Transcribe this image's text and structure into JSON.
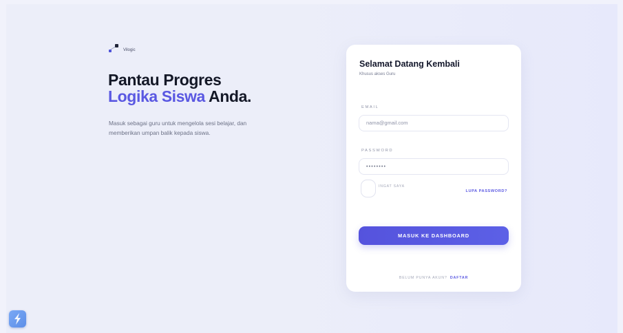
{
  "brand": {
    "name": "Vilogic",
    "logo_icon": "vilogic-logo-icon"
  },
  "hero": {
    "line1": "Pantau Progres",
    "accent": "Logika Siswa",
    "suffix": " Anda.",
    "description": "Masuk sebagai guru untuk mengelola sesi belajar, dan memberikan umpan balik kepada siswa."
  },
  "login": {
    "title": "Selamat Datang Kembali",
    "subtitle": "Khusus akses Guru",
    "email_label": "EMAIL",
    "email_placeholder": "nama@gmail.com",
    "password_label": "PASSWORD",
    "password_value": "••••••••",
    "remember_label": "INGAT SAYA",
    "forgot_label": "LUPA PASSWORD?",
    "submit_label": "MASUK KE DASHBOARD",
    "register_prompt": "BELUM PUNYA AKUN?",
    "register_link": "DAFTAR"
  },
  "colors": {
    "accent": "#5a58e2",
    "background": "#eceef9",
    "card": "#ffffff"
  },
  "dock": {
    "app_icon": "lightning-app-icon"
  }
}
